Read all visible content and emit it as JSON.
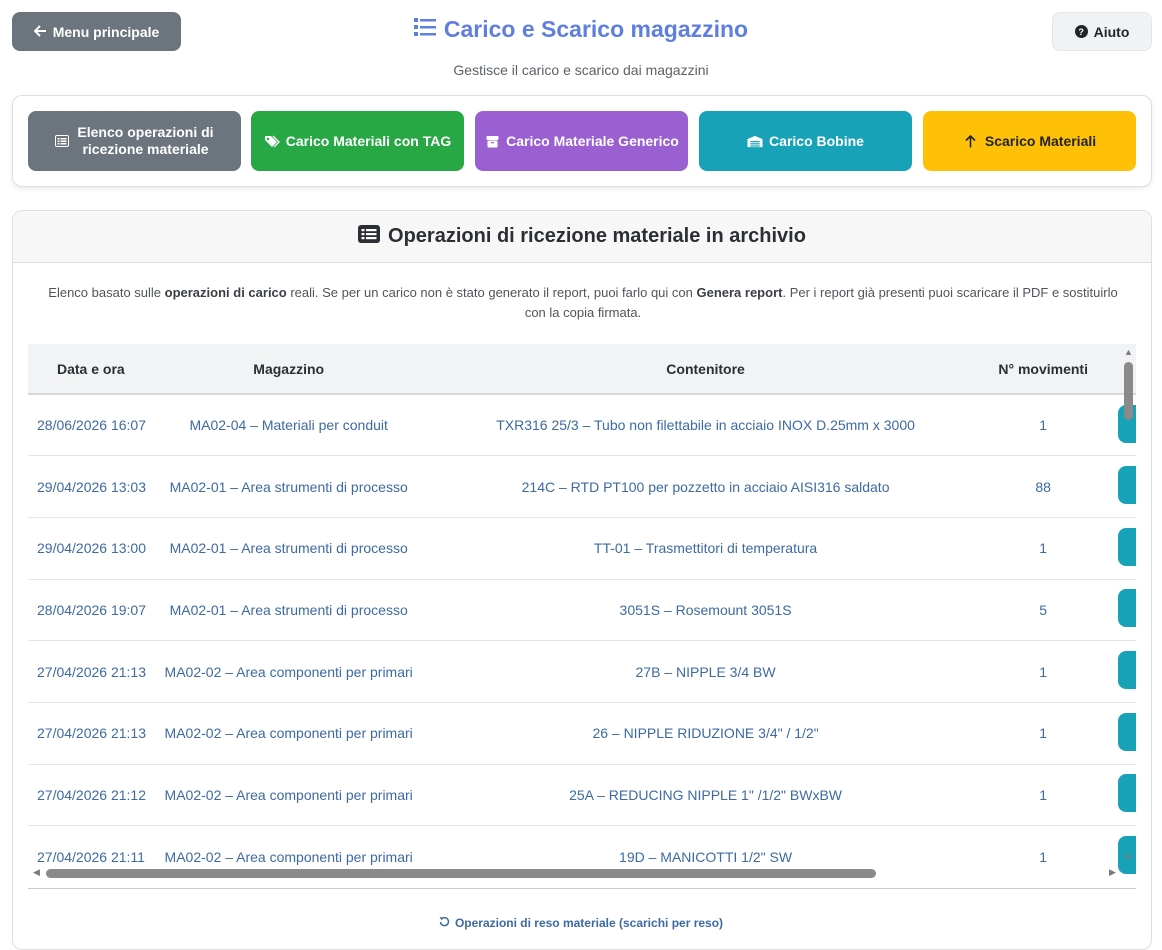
{
  "header": {
    "back_label": "Menu principale",
    "title": "Carico e Scarico magazzino",
    "subtitle": "Gestisce il carico e scarico dai magazzini",
    "help_label": "Aiuto"
  },
  "actions": [
    {
      "label": "Elenco operazioni di ricezione materiale",
      "color": "#6c757d",
      "icon": "list-icon"
    },
    {
      "label": "Carico Materiali con TAG",
      "color": "#28a745",
      "icon": "tags-icon"
    },
    {
      "label": "Carico Materiale Generico",
      "color": "#9a5fd0",
      "icon": "box-icon"
    },
    {
      "label": "Carico Bobine",
      "color": "#17a2b8",
      "icon": "warehouse-icon"
    },
    {
      "label": "Scarico Materiali",
      "color": "#ffc107",
      "icon": "arrow-up-icon"
    }
  ],
  "archive": {
    "title": "Operazioni di ricezione materiale in archivio",
    "desc_part1": "Elenco basato sulle ",
    "desc_bold1": "operazioni di carico",
    "desc_part2": " reali. Se per un carico non è stato generato il report, puoi farlo qui con ",
    "desc_bold2": "Genera report",
    "desc_part3": ". Per i report già presenti puoi scaricare il PDF e sostituirlo con la copia firmata."
  },
  "table": {
    "columns": [
      "Data e ora",
      "Magazzino",
      "Contenitore",
      "N° movimenti"
    ],
    "rows": [
      {
        "date": "28/06/2026 16:07",
        "mag": "MA02-04 – Materiali per conduit",
        "cont": "TXR316 25/3 – Tubo non filettabile in acciaio INOX D.25mm x 3000",
        "mov": "1"
      },
      {
        "date": "29/04/2026 13:03",
        "mag": "MA02-01 – Area strumenti di processo",
        "cont": "214C – RTD PT100 per pozzetto in acciaio AISI316 saldato",
        "mov": "88"
      },
      {
        "date": "29/04/2026 13:00",
        "mag": "MA02-01 – Area strumenti di processo",
        "cont": "TT-01 – Trasmettitori di temperatura",
        "mov": "1"
      },
      {
        "date": "28/04/2026 19:07",
        "mag": "MA02-01 – Area strumenti di processo",
        "cont": "3051S – Rosemount 3051S",
        "mov": "5"
      },
      {
        "date": "27/04/2026 21:13",
        "mag": "MA02-02 – Area componenti per primari",
        "cont": "27B – NIPPLE 3/4 BW",
        "mov": "1"
      },
      {
        "date": "27/04/2026 21:13",
        "mag": "MA02-02 – Area componenti per primari",
        "cont": "26 – NIPPLE RIDUZIONE 3/4\" / 1/2\"",
        "mov": "1"
      },
      {
        "date": "27/04/2026 21:12",
        "mag": "MA02-02 – Area componenti per primari",
        "cont": "25A – REDUCING NIPPLE 1\" /1/2\" BWxBW",
        "mov": "1"
      },
      {
        "date": "27/04/2026 21:11",
        "mag": "MA02-02 – Area componenti per primari",
        "cont": "19D – MANICOTTI 1/2\" SW",
        "mov": "1"
      }
    ]
  },
  "footer": {
    "reso_label": "Operazioni di reso materiale (scarichi per reso)"
  }
}
